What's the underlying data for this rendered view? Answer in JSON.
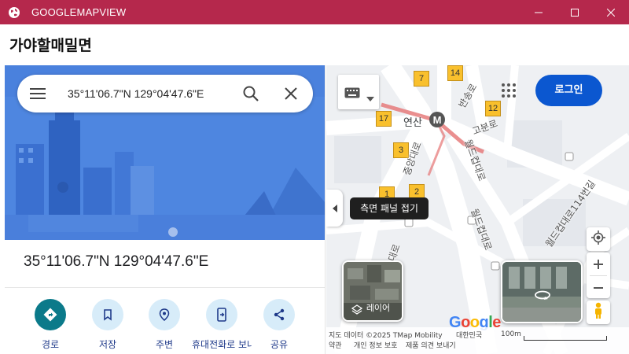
{
  "window": {
    "title": "GOOGLEMAPVIEW"
  },
  "header": {
    "title": "가야할매밀면"
  },
  "search": {
    "query": "35°11'06.7\"N 129°04'47.6\"E"
  },
  "place": {
    "coordinates": "35°11'06.7\"N 129°04'47.6\"E"
  },
  "actions": [
    {
      "label": "경로",
      "icon": "directions-icon"
    },
    {
      "label": "저장",
      "icon": "bookmark-icon"
    },
    {
      "label": "주변",
      "icon": "nearby-icon"
    },
    {
      "label": "휴대전화로 보내기",
      "icon": "send-to-phone-icon"
    },
    {
      "label": "공유",
      "icon": "share-icon"
    }
  ],
  "map": {
    "login_label": "로그인",
    "tooltip": "측면 패널 접기",
    "layers_label": "레이어",
    "badges": [
      "7",
      "14",
      "12",
      "17",
      "3",
      "1",
      "2"
    ],
    "place_labels": {
      "station": "연산",
      "road_bansong": "반송로",
      "road_gobun": "고분로",
      "road_jungang": "중앙대로",
      "road_worldcup1": "월드컵대로",
      "road_worldcup2": "월드컵대로",
      "road_worldcup114": "월드컵대로114번길",
      "road_jungang2": "중앙대로"
    },
    "footer": {
      "data": "지도 데이터 ©2025 TMap Mobility",
      "country": "대한민국",
      "terms": "약관",
      "privacy": "개인 정보 보호",
      "feedback": "제품 의견 보내기",
      "scale": "100m"
    },
    "colors": {
      "login_bg": "#0b57d0",
      "badge": "#f9c02d",
      "metro_line": "#e57373"
    }
  },
  "colors": {
    "titlebar": "#b5284c",
    "hero": "#4a81dd",
    "primary_action": "#0b7a8a"
  }
}
